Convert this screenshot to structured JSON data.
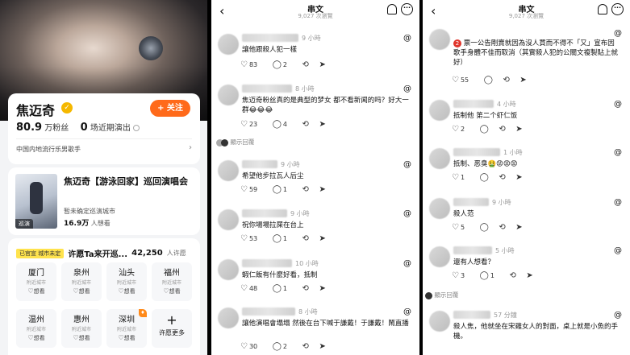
{
  "profile": {
    "name": "焦迈奇",
    "follow_label": "+ 关注",
    "followers_value": "80.9",
    "followers_unit": "万粉丝",
    "recent_value": "0",
    "recent_unit": "场近期演出",
    "tag_line": "中国内地流行乐男歌手"
  },
  "tour": {
    "poster_tag": "巡演",
    "title": "焦迈奇【游泳回家】巡回演唱会",
    "subtitle": "暂未确定巡演城市",
    "want_value": "16.9万",
    "want_unit": "人想看"
  },
  "cities": {
    "badge": "已官宣 城市未定",
    "title": "许愿Ta来开巡...",
    "count": "42,250",
    "count_unit": "人许愿",
    "items": [
      {
        "name": "厦门",
        "sub": "附近城市",
        "want": "想看"
      },
      {
        "name": "泉州",
        "sub": "附近城市",
        "want": "想看"
      },
      {
        "name": "汕头",
        "sub": "附近城市",
        "want": "想看"
      },
      {
        "name": "福州",
        "sub": "附近城市",
        "want": "想看"
      },
      {
        "name": "温州",
        "sub": "附近城市",
        "want": "想看"
      },
      {
        "name": "惠州",
        "sub": "附近城市",
        "want": "想看"
      },
      {
        "name": "深圳",
        "sub": "附近城市",
        "want": "想看"
      }
    ],
    "more_label": "许愿更多"
  },
  "thread_mid": {
    "title": "串文",
    "views": "9,027 次瀏覽",
    "posts": [
      {
        "time": "9 小時",
        "body": "讓他跟殺人犯一樣",
        "likes": "83",
        "comments": "2",
        "reposts": "",
        "shares": ""
      },
      {
        "time": "8 小時",
        "body": "焦迈奇粉丝真的是典型的梦女 都不看新闻的吗？好大一群😂😂😂",
        "likes": "23",
        "comments": "4",
        "reposts": "",
        "shares": "",
        "reply_label": "顯示回覆"
      },
      {
        "time": "9 小時",
        "body": "希望他步拉瓦人后尘",
        "likes": "59",
        "comments": "1",
        "reposts": "",
        "shares": ""
      },
      {
        "time": "9 小時",
        "body": "祝你場場拉屎在台上",
        "likes": "53",
        "comments": "1",
        "reposts": "",
        "shares": ""
      },
      {
        "time": "10 小時",
        "body": "蝦仁飯有什麼好看，抵制",
        "likes": "48",
        "comments": "1",
        "reposts": "",
        "shares": ""
      },
      {
        "time": "8 小時",
        "body": "讓他演唱會塌塌 然後在台下喊于謙戴！于謙戴！鬧直播",
        "likes": "30",
        "comments": "2",
        "reposts": "",
        "shares": ""
      }
    ]
  },
  "thread_right": {
    "title": "串文",
    "views": "9,027 次瀏覽",
    "posts": [
      {
        "time": "",
        "badge": "2",
        "body": "票一公告剛賣就因為沒人買而不得不「又」宣布因歌手身體不佳而取消（其實殺人犯的公關文複製貼上就好）",
        "likes": "55",
        "comments": "",
        "reposts": "",
        "shares": ""
      },
      {
        "time": "4 小時",
        "body": "抵制他 第二个虾仁饭",
        "likes": "2",
        "comments": "",
        "reposts": "",
        "shares": ""
      },
      {
        "time": "1 小時",
        "body": "抵制、恶臭🤮😡😡😡",
        "likes": "1",
        "comments": "",
        "reposts": "",
        "shares": ""
      },
      {
        "time": "9 小時",
        "body": "殺人范",
        "likes": "5",
        "comments": "",
        "reposts": "",
        "shares": ""
      },
      {
        "time": "5 小時",
        "body": "還有人想看？",
        "likes": "3",
        "comments": "1",
        "reposts": "",
        "shares": "",
        "reply_label": "顯示回覆"
      },
      {
        "time": "57 分鐘",
        "body": "殺人焦，他就坐在宋雞女人的對面，桌上就是小魚的手機。",
        "likes": "",
        "comments": "",
        "reposts": "",
        "shares": ""
      }
    ]
  },
  "icons": {
    "like": "heart-icon",
    "comment": "comment-icon",
    "repost": "repost-icon",
    "share": "share-icon",
    "threads": "threads-logo-icon",
    "back": "back-arrow-icon",
    "bell": "bell-icon",
    "more": "more-icon"
  },
  "colors": {
    "accent_orange": "#ff6a1a",
    "badge_yellow": "#ffe34d",
    "verify": "#f5b800"
  }
}
